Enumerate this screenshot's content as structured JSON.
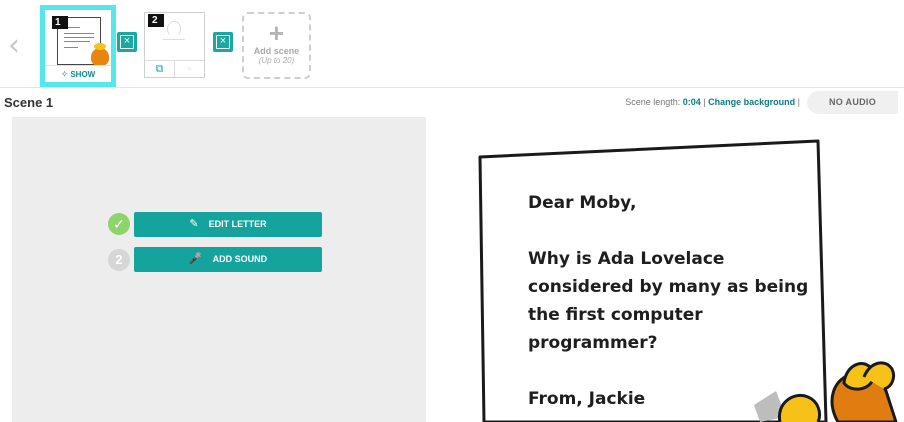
{
  "strip": {
    "scene1": {
      "number": "1",
      "show_label": "SHOW"
    },
    "scene2": {
      "number": "2"
    },
    "add_scene": {
      "label": "Add scene",
      "sub": "(Up to 20)"
    }
  },
  "scene_bar": {
    "title": "Scene 1",
    "length_label": "Scene length: ",
    "length_value": "0:04",
    "separator": " | ",
    "change_background": "Change background",
    "separator2": " |",
    "audio_button": "NO AUDIO"
  },
  "editor": {
    "step2_number": "2",
    "edit_letter": "EDIT LETTER",
    "add_sound": "ADD SOUND"
  },
  "letter": {
    "greeting": "Dear Moby,",
    "body_lines": [
      "Why is Ada Lovelace",
      "considered by many as being",
      "the first computer",
      "programmer?"
    ],
    "signature": "From, Jackie"
  },
  "colors": {
    "teal": "#15a39e",
    "thumbnail_highlight": "#55e6ee",
    "check_green": "#8fd46a"
  },
  "icons": {
    "prev": "chevron-left-icon",
    "show": "eye-icon",
    "delete": "x-box-icon",
    "copy": "copy-icon",
    "trash": "trash-icon",
    "add": "plus-icon",
    "edit": "pencil-icon",
    "sound": "microphone-icon",
    "done": "checkmark-icon"
  }
}
